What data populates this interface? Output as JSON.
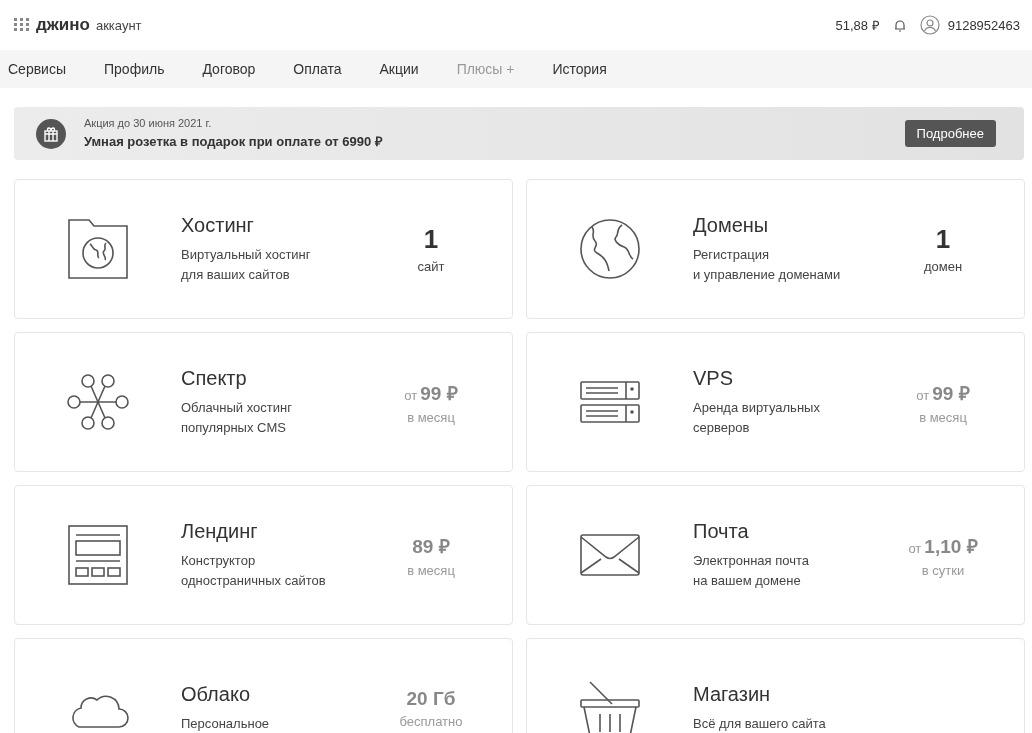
{
  "header": {
    "logo": "джино",
    "logo_suffix": "аккаунт",
    "balance": "51,88 ₽",
    "account": "9128952463"
  },
  "nav": [
    {
      "label": "Сервисы",
      "muted": false
    },
    {
      "label": "Профиль",
      "muted": false
    },
    {
      "label": "Договор",
      "muted": false
    },
    {
      "label": "Оплата",
      "muted": false
    },
    {
      "label": "Акции",
      "muted": false
    },
    {
      "label": "Плюсы +",
      "muted": true
    },
    {
      "label": "История",
      "muted": false
    }
  ],
  "promo": {
    "date": "Акция до 30 июня 2021 г.",
    "text": "Умная розетка в подарок при оплате от 6990 ₽",
    "button": "Подробнее"
  },
  "services": [
    {
      "kind": "folder-globe",
      "title": "Хостинг",
      "description": [
        "Виртуальный хостинг",
        "для ваших сайтов"
      ],
      "value": {
        "kind": "count",
        "amount": "1",
        "unit": "сайт"
      }
    },
    {
      "kind": "globe",
      "title": "Домены",
      "description": [
        "Регистрация",
        "и управление доменами"
      ],
      "value": {
        "kind": "count",
        "amount": "1",
        "unit": "домен"
      }
    },
    {
      "kind": "network",
      "title": "Спектр",
      "description": [
        "Облачный хостинг",
        "популярных CMS"
      ],
      "value": {
        "kind": "price",
        "prefix": "от",
        "amount": "99 ₽",
        "unit": "в месяц"
      }
    },
    {
      "kind": "server",
      "title": "VPS",
      "description": [
        "Аренда виртуальных",
        "серверов"
      ],
      "value": {
        "kind": "price",
        "prefix": "от",
        "amount": "99 ₽",
        "unit": "в месяц"
      }
    },
    {
      "kind": "landing",
      "title": "Лендинг",
      "description": [
        "Конструктор",
        "одностраничных сайтов"
      ],
      "value": {
        "kind": "price",
        "amount": "89 ₽",
        "unit": "в месяц"
      }
    },
    {
      "kind": "envelope",
      "title": "Почта",
      "description": [
        "Электронная почта",
        "на вашем домене"
      ],
      "value": {
        "kind": "price",
        "prefix": "от",
        "amount": "1,10 ₽",
        "unit": "в сутки"
      }
    },
    {
      "kind": "cloud",
      "title": "Облако",
      "description": [
        "Персональное"
      ],
      "value": {
        "kind": "price",
        "amount": "20 Гб",
        "unit": "бесплатно"
      }
    },
    {
      "kind": "basket",
      "title": "Магазин",
      "description": [
        "Всё для вашего сайта"
      ],
      "value": {
        "kind": "none"
      }
    }
  ]
}
